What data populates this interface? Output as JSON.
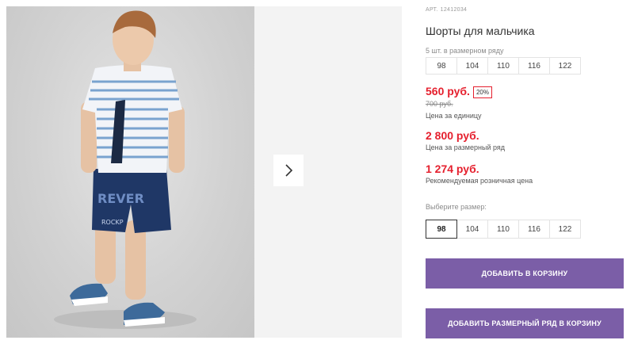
{
  "product": {
    "article_label": "АРТ.",
    "article_number": "12412034",
    "title": "Шорты для мальчика",
    "image_icon": "boy-in-shorts-photo"
  },
  "size_series": {
    "label": "5 шт. в размерном ряду",
    "sizes": [
      "98",
      "104",
      "110",
      "116",
      "122"
    ]
  },
  "pricing": {
    "unit_price": "560 руб.",
    "discount_badge": "20%",
    "old_price": "700 руб.",
    "unit_caption": "Цена за единицу",
    "row_price": "2 800 руб.",
    "row_caption": "Цена за размерный ряд",
    "rrp_price": "1 274 руб.",
    "rrp_caption": "Рекомендуемая розничная цена"
  },
  "size_select": {
    "label": "Выберите размер:",
    "sizes": [
      "98",
      "104",
      "110",
      "116",
      "122"
    ],
    "selected": "98"
  },
  "actions": {
    "add_to_cart": "Добавить в корзину",
    "add_row_to_cart": "Добавить размерный ряд в корзину"
  },
  "gallery": {
    "next_icon": "chevron-right-icon"
  },
  "colors": {
    "price_red": "#e5202e",
    "button_purple": "#7b5ea7"
  }
}
